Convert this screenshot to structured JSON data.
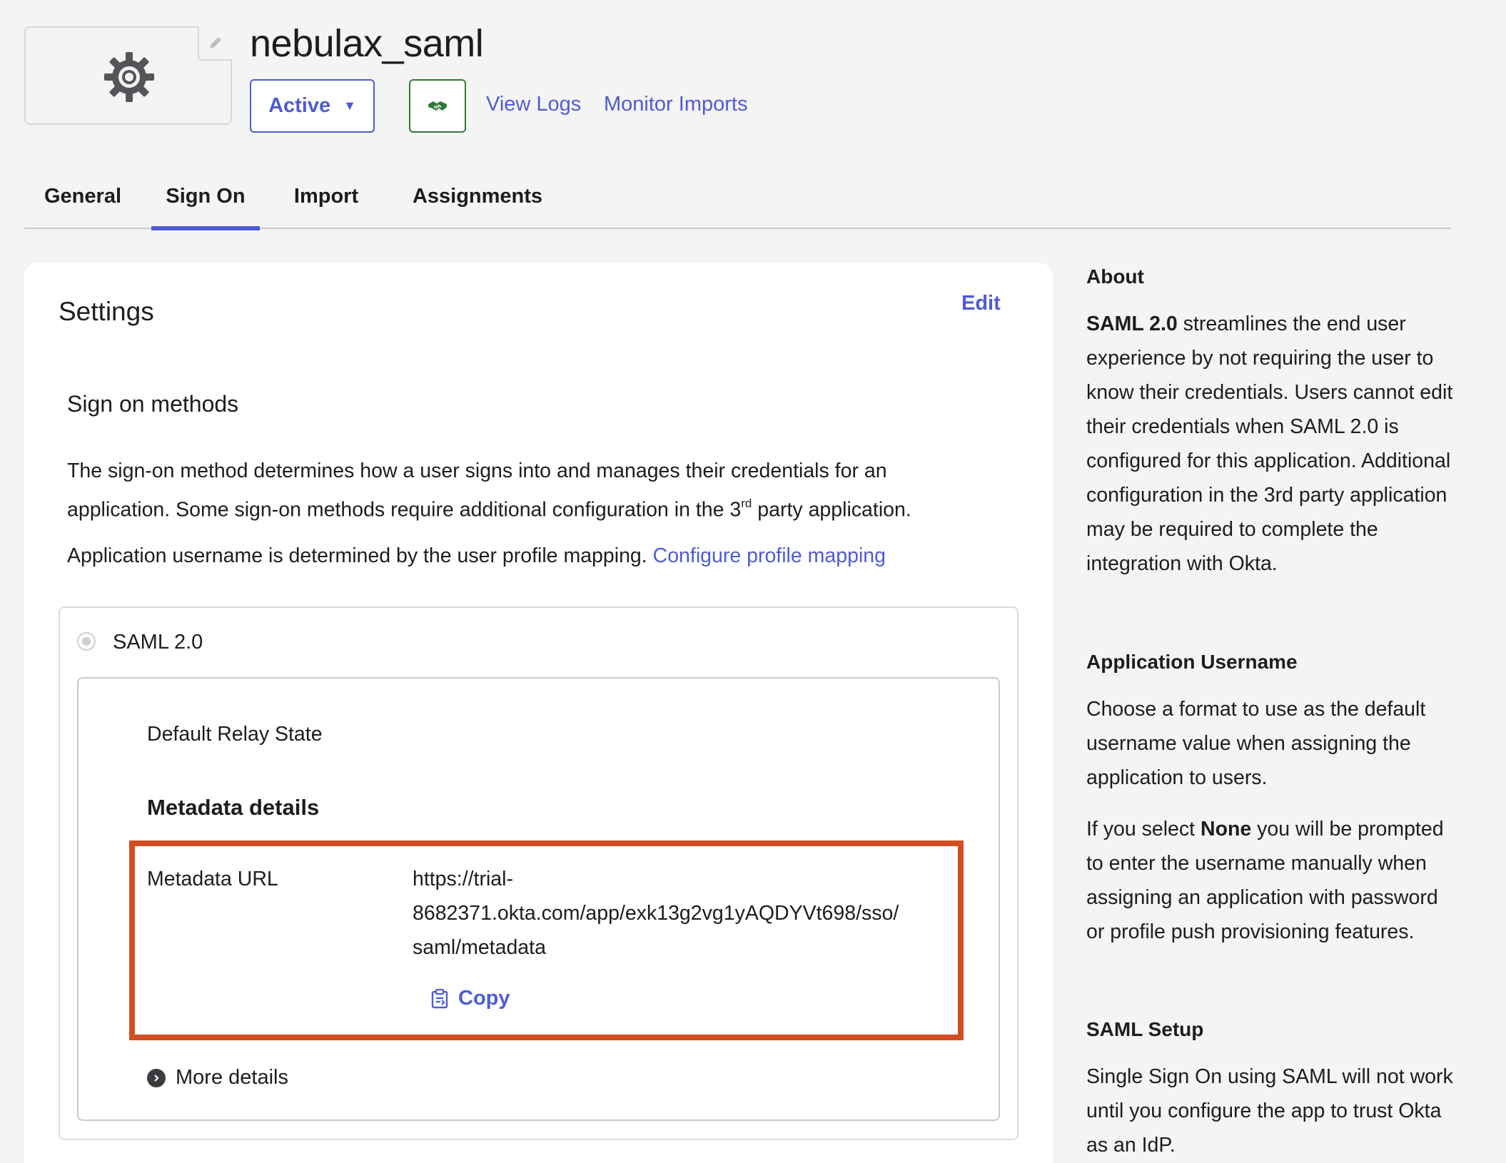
{
  "app": {
    "title": "nebulax_saml",
    "status": "Active",
    "logo_icon": "gear-icon",
    "push_icon": "handshake-icon"
  },
  "header_links": {
    "view_logs": "View Logs",
    "monitor_imports": "Monitor Imports"
  },
  "tabs": [
    {
      "label": "General",
      "active": false
    },
    {
      "label": "Sign On",
      "active": true
    },
    {
      "label": "Import",
      "active": false
    },
    {
      "label": "Assignments",
      "active": false
    }
  ],
  "settings": {
    "title": "Settings",
    "edit": "Edit",
    "section_title": "Sign on methods",
    "description_part1": "The sign-on method determines how a user signs into and manages their credentials for an application. Some sign-on methods require additional configuration in the 3",
    "description_sup": "rd",
    "description_part2": " party application.",
    "username_text": "Application username is determined by the user profile mapping. ",
    "username_link": "Configure profile mapping",
    "method_label": "SAML 2.0",
    "relay_state_label": "Default Relay State",
    "metadata_title": "Metadata details",
    "metadata_url_label": "Metadata URL",
    "metadata_url_line1": "https://trial-",
    "metadata_url_line2": "8682371.okta.com/app/exk13g2vg1yAQDYVt698/sso/",
    "metadata_url_line3": "saml/metadata",
    "copy": "Copy",
    "more_details": "More details"
  },
  "sidebar": {
    "about_title": "About",
    "about_bold": "SAML 2.0",
    "about_text": " streamlines the end user experience by not requiring the user to know their credentials. Users cannot edit their credentials when SAML 2.0 is configured for this application. Additional configuration in the 3rd party application may be required to complete the integration with Okta.",
    "username_title": "Application Username",
    "username_text": "Choose a format to use as the default username value when assigning the application to users.",
    "none_pre": "If you select ",
    "none_bold": "None",
    "none_post": " you will be prompted to enter the username manually when assigning an application with password or profile push provisioning features.",
    "saml_setup_title": "SAML Setup",
    "saml_setup_text": "Single Sign On using SAML will not work until you configure the app to trust Okta as an IdP."
  },
  "colors": {
    "accent": "#4f5bd5",
    "highlight": "#d24e22",
    "push_green": "#2f7a38"
  }
}
